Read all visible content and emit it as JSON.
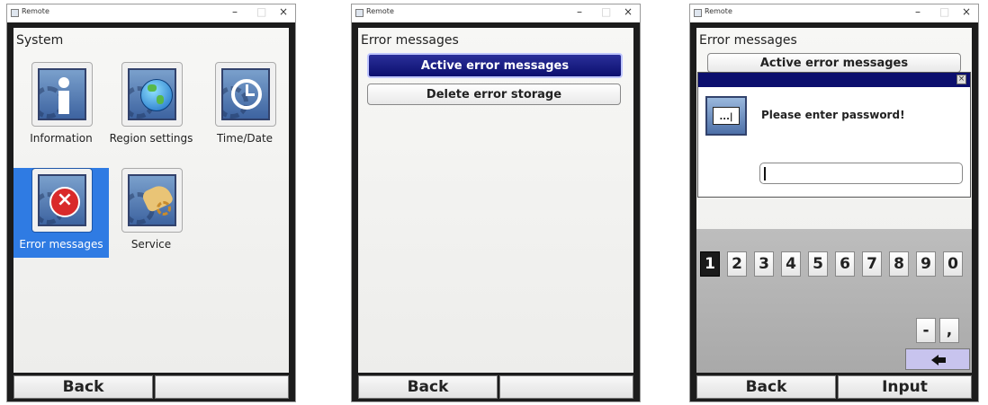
{
  "windows": [
    {
      "title": "Remote",
      "controls": {
        "minimize": "–",
        "maximize": "□",
        "close": "×"
      },
      "heading": "System",
      "tiles": [
        {
          "label": "Information",
          "icon": "information-icon",
          "selected": false
        },
        {
          "label": "Region settings",
          "icon": "globe-icon",
          "selected": false
        },
        {
          "label": "Time/Date",
          "icon": "clock-icon",
          "selected": false
        },
        {
          "label": "Error messages",
          "icon": "error-icon",
          "selected": true
        },
        {
          "label": "Service",
          "icon": "service-hand-icon",
          "selected": false
        }
      ],
      "softkeys": {
        "left": "Back",
        "right": ""
      }
    },
    {
      "title": "Remote",
      "controls": {
        "minimize": "–",
        "maximize": "□",
        "close": "×"
      },
      "heading": "Error messages",
      "buttons": [
        {
          "label": "Active error messages",
          "active": true
        },
        {
          "label": "Delete error storage",
          "active": false
        }
      ],
      "softkeys": {
        "left": "Back",
        "right": ""
      }
    },
    {
      "title": "Remote",
      "controls": {
        "minimize": "–",
        "maximize": "□",
        "close": "×"
      },
      "heading": "Error messages",
      "buttons": [
        {
          "label": "Active error messages",
          "active": false
        }
      ],
      "dialog": {
        "message": "Please enter password!",
        "input_value": "",
        "icon": "password-dots-icon",
        "close_icon": "close-box-icon"
      },
      "keypad": {
        "digits": [
          "1",
          "2",
          "3",
          "4",
          "5",
          "6",
          "7",
          "8",
          "9",
          "0"
        ],
        "selected_digit": "1",
        "extra": [
          "-",
          ","
        ],
        "backspace_icon": "arrow-left-icon"
      },
      "softkeys": {
        "left": "Back",
        "right": "Input"
      }
    }
  ],
  "colors": {
    "selection": "#2f7be3",
    "active_button": "#0c0f6e",
    "backspace_key": "#c8c4ee",
    "error_red": "#d92a2a"
  }
}
